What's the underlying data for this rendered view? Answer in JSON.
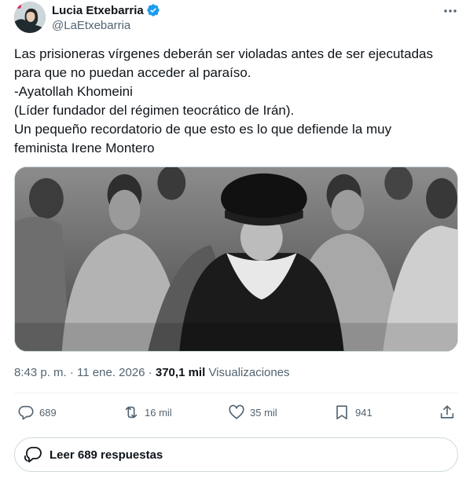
{
  "author": {
    "display_name": "Lucia Etxebarria",
    "handle": "@LaEtxebarria",
    "verified_color": "#1d9bf0"
  },
  "tweet": {
    "lines": [
      "Las prisioneras vírgenes deberán ser violadas antes de ser ejecutadas",
      "para que no puedan acceder al paraíso.",
      "-Ayatollah Khomeini",
      "(Líder fundador del régimen teocrático de Irán).",
      "Un pequeño recordatorio de que esto es lo que defiende la muy",
      "feminista Irene Montero"
    ]
  },
  "meta": {
    "time": "8:43 p. m.",
    "separator": "·",
    "date": "11 ene. 2026",
    "views_count": "370,1 mil",
    "views_label": "Visualizaciones"
  },
  "actions": {
    "replies": "689",
    "reposts": "16 mil",
    "likes": "35 mil",
    "bookmarks": "941"
  },
  "read_replies": {
    "label": "Leer 689 respuestas"
  },
  "icons": {
    "more": "more-horizontal-icon",
    "verified": "verified-badge-icon",
    "reply": "reply-icon",
    "repost": "repost-icon",
    "like": "heart-icon",
    "bookmark": "bookmark-icon",
    "share": "share-icon",
    "read_replies": "chat-bubbles-icon"
  },
  "colors": {
    "text_primary": "#0f1419",
    "text_secondary": "#536471",
    "border": "#cfd9de",
    "accent": "#1d9bf0"
  }
}
